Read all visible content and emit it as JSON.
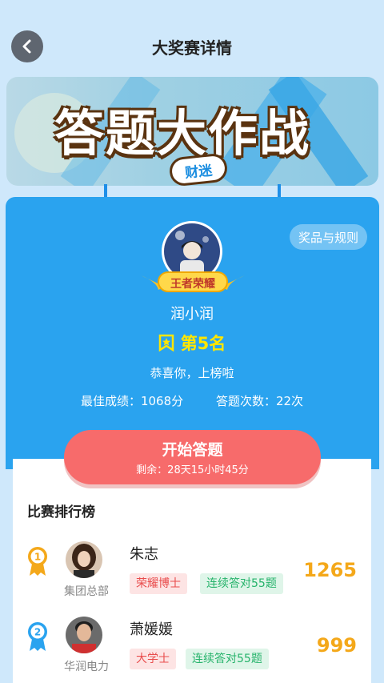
{
  "header": {
    "title": "大奖赛详情"
  },
  "banner": {
    "title": "答题大作战",
    "tag": "财迷"
  },
  "profile": {
    "rules_label": "奖品与规则",
    "badge": "王者荣耀",
    "name": "润小润",
    "rank": "第5名",
    "congrats": "恭喜你，上榜啦",
    "best_score": "最佳成绩：1068分",
    "answer_count": "答题次数：22次"
  },
  "start": {
    "label": "开始答题",
    "remaining": "剩余：28天15小时45分"
  },
  "leaderboard": {
    "title": "比赛排行榜",
    "rows": [
      {
        "rank": "1",
        "name": "朱志",
        "company": "集团总部",
        "tag1": "荣耀博士",
        "tag2": "连续答对55题",
        "score": "1265"
      },
      {
        "rank": "2",
        "name": "萧媛媛",
        "company": "华润电力",
        "tag1": "大学士",
        "tag2": "连续答对55题",
        "score": "999"
      }
    ]
  },
  "colors": {
    "primary": "#2aa3ef",
    "start": "#f76b6b",
    "gold": "#f4a81a"
  }
}
